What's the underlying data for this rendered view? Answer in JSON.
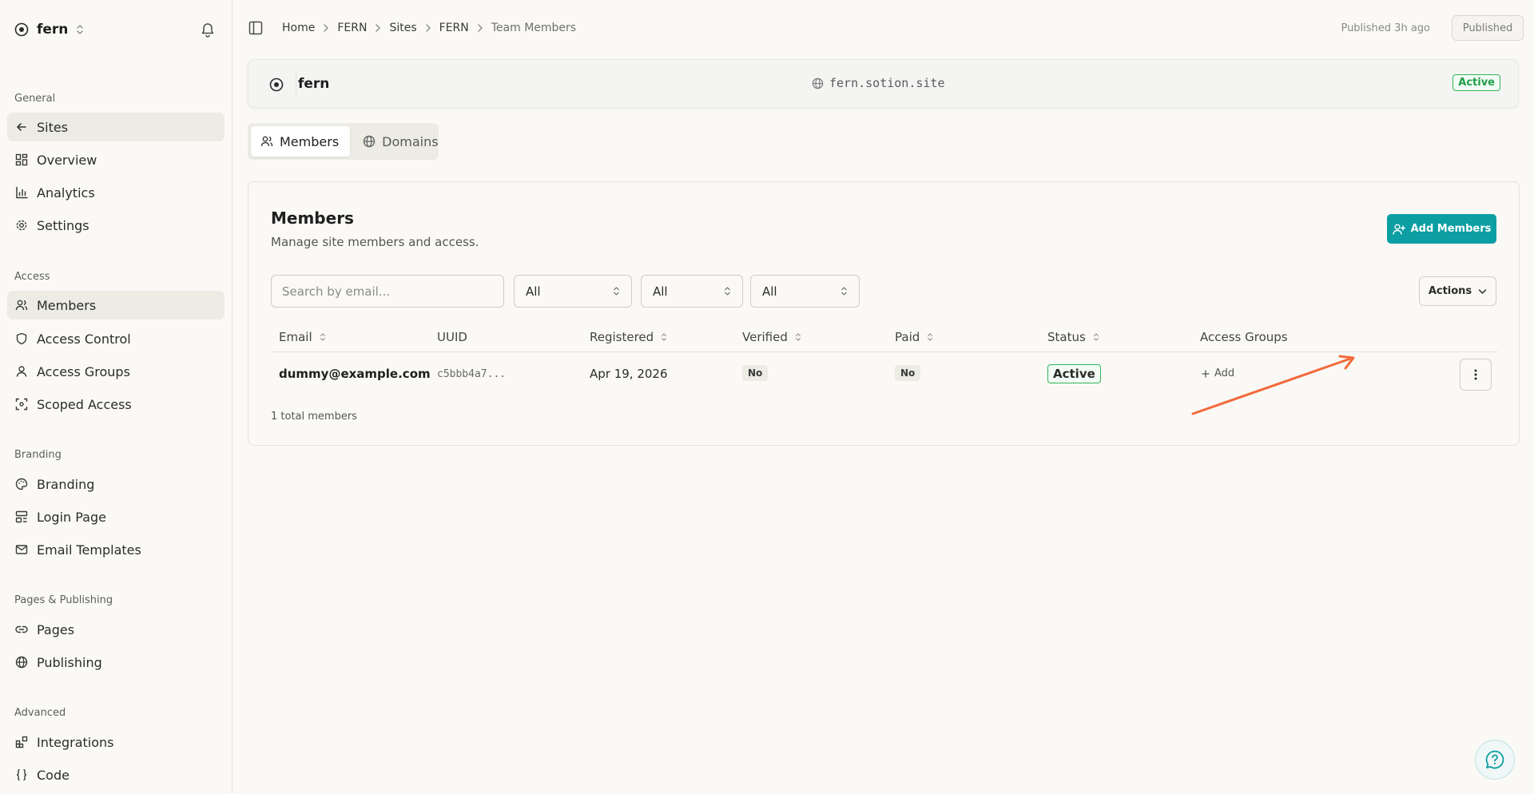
{
  "workspace": {
    "name": "fern"
  },
  "sidebar": {
    "sections": [
      {
        "title": "General",
        "items": [
          {
            "label": "Sites",
            "icon": "arrow-left-icon",
            "active": true
          },
          {
            "label": "Overview",
            "icon": "dashboard-icon"
          },
          {
            "label": "Analytics",
            "icon": "bar-chart-icon"
          },
          {
            "label": "Settings",
            "icon": "gear-icon"
          }
        ]
      },
      {
        "title": "Access",
        "items": [
          {
            "label": "Members",
            "icon": "users-icon",
            "active": true
          },
          {
            "label": "Access Control",
            "icon": "shield-icon"
          },
          {
            "label": "Access Groups",
            "icon": "user-icon"
          },
          {
            "label": "Scoped Access",
            "icon": "scope-icon"
          }
        ]
      },
      {
        "title": "Branding",
        "items": [
          {
            "label": "Branding",
            "icon": "palette-icon"
          },
          {
            "label": "Login Page",
            "icon": "layout-icon"
          },
          {
            "label": "Email Templates",
            "icon": "mail-icon"
          }
        ]
      },
      {
        "title": "Pages & Publishing",
        "items": [
          {
            "label": "Pages",
            "icon": "link-icon"
          },
          {
            "label": "Publishing",
            "icon": "globe-icon"
          }
        ]
      },
      {
        "title": "Advanced",
        "items": [
          {
            "label": "Integrations",
            "icon": "blocks-icon"
          },
          {
            "label": "Code",
            "icon": "braces-icon"
          }
        ]
      }
    ]
  },
  "breadcrumb": [
    "Home",
    "FERN",
    "Sites",
    "FERN",
    "Team Members"
  ],
  "header": {
    "published_text": "Published 3h ago",
    "published_button": "Published"
  },
  "site": {
    "name": "fern",
    "domain": "fern.sotion.site",
    "status": "Active"
  },
  "tabs": [
    {
      "label": "Members",
      "icon": "users-icon",
      "active": true
    },
    {
      "label": "Domains",
      "icon": "globe-icon",
      "active": false
    }
  ],
  "members": {
    "title": "Members",
    "subtitle": "Manage site members and access.",
    "add_button": "Add Members",
    "search_placeholder": "Search by email...",
    "filters": [
      "All",
      "All",
      "All"
    ],
    "actions_label": "Actions",
    "columns": [
      "Email",
      "UUID",
      "Registered",
      "Verified",
      "Paid",
      "Status",
      "Access Groups"
    ],
    "rows": [
      {
        "email": "dummy@example.com",
        "uuid": "c5bbb4a7...",
        "registered": "Apr 19, 2026",
        "verified": "No",
        "paid": "No",
        "status": "Active",
        "access_groups_action": "Add"
      }
    ],
    "total": "1 total members"
  },
  "colors": {
    "accent": "#0b9ea3",
    "active_green": "#2fb55a",
    "annotation_arrow": "#f26b3a"
  }
}
